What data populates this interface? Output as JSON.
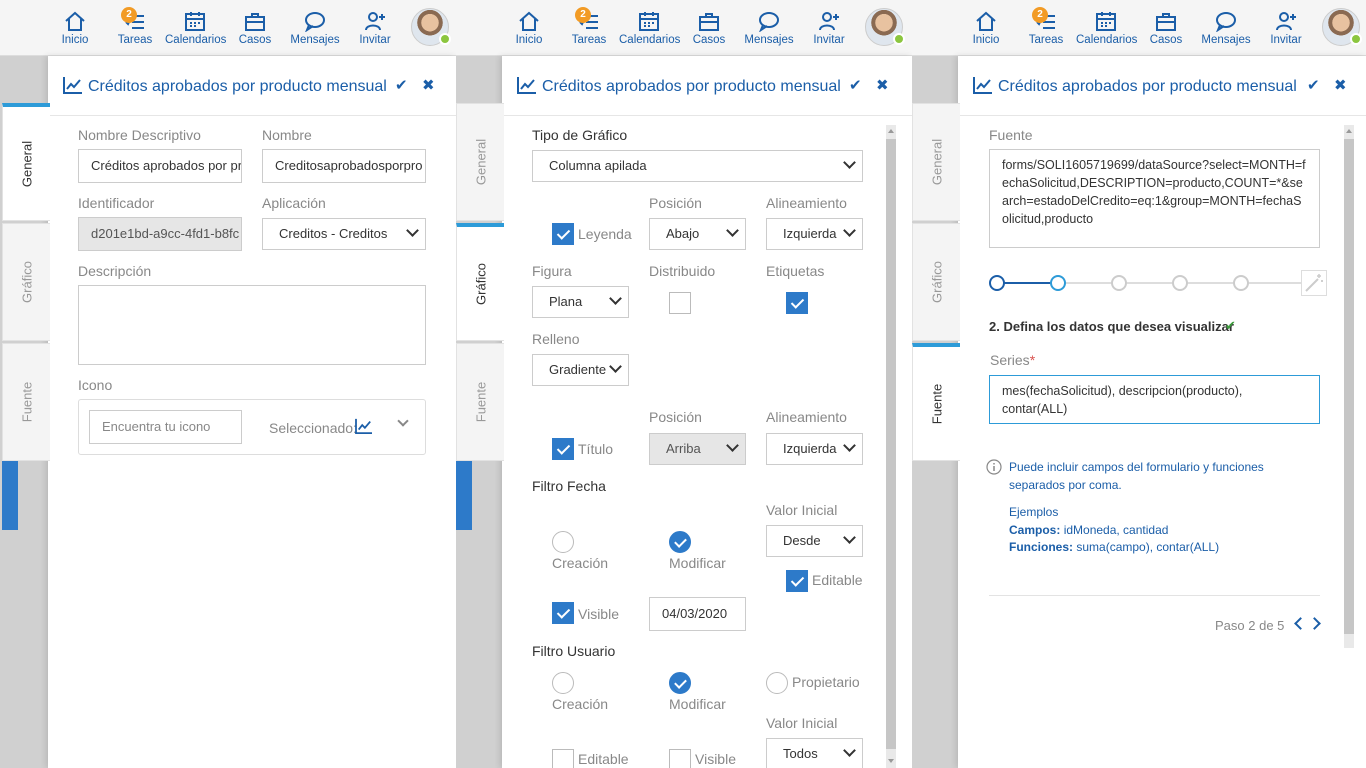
{
  "nav": {
    "inicio": "Inicio",
    "tareas": "Tareas",
    "tareas_badge": "2",
    "calendarios": "Calendarios",
    "casos": "Casos",
    "mensajes": "Mensajes",
    "invitar": "Invitar"
  },
  "panel": {
    "title": "Créditos aprobados por producto mensual",
    "tabs": {
      "general": "General",
      "grafico": "Gráfico",
      "fuente": "Fuente"
    }
  },
  "general": {
    "nombre_descriptivo_label": "Nombre Descriptivo",
    "nombre_descriptivo_value": "Créditos aprobados por pr",
    "nombre_label": "Nombre",
    "nombre_value": "Creditosaprobadosporpro",
    "identificador_label": "Identificador",
    "identificador_value": "d201e1bd-a9cc-4fd1-b8fc",
    "aplicacion_label": "Aplicación",
    "aplicacion_value": "Creditos - Creditos",
    "descripcion_label": "Descripción",
    "descripcion_value": "",
    "icono_label": "Icono",
    "icono_placeholder": "Encuentra tu icono",
    "seleccionado_label": "Seleccionado:"
  },
  "grafico": {
    "tipo_label": "Tipo de Gráfico",
    "tipo_value": "Columna apilada",
    "posicion_label": "Posición",
    "alineamiento_label": "Alineamiento",
    "leyenda_label": "Leyenda",
    "leyenda_posicion": "Abajo",
    "leyenda_alineamiento": "Izquierda",
    "figura_label": "Figura",
    "figura_value": "Plana",
    "distribuido_label": "Distribuido",
    "etiquetas_label": "Etiquetas",
    "relleno_label": "Relleno",
    "relleno_value": "Gradiente",
    "posicion2_label": "Posición",
    "alineamiento2_label": "Alineamiento",
    "titulo_label": "Título",
    "titulo_posicion": "Arriba",
    "titulo_alineamiento": "Izquierda",
    "filtro_fecha_label": "Filtro Fecha",
    "valor_inicial_label": "Valor Inicial",
    "creacion_label": "Creación",
    "modificar_label": "Modificar",
    "fecha_valor_inicial": "Desde",
    "editable_label": "Editable",
    "visible_label": "Visible",
    "fecha_value": "04/03/2020",
    "filtro_usuario_label": "Filtro Usuario",
    "creacion2_label": "Creación",
    "modificar2_label": "Modificar",
    "propietario_label": "Propietario",
    "valor_inicial2_label": "Valor Inicial",
    "editable2_label": "Editable",
    "visible2_label": "Visible",
    "usuario_valor_inicial": "Todos"
  },
  "fuente": {
    "fuente_label": "Fuente",
    "fuente_value": "forms/SOLI1605719699/dataSource?select=MONTH=fechaSolicitud,DESCRIPTION=producto,COUNT=*&search=estadoDelCredito=eq:1&group=MONTH=fechaSolicitud,producto",
    "step_title": "2. Defina los datos que desea visualizar",
    "series_label": "Series",
    "required_mark": "*",
    "series_value": "mes(fechaSolicitud), descripcion(producto), contar(ALL)",
    "info_line1": "Puede incluir campos del formulario y funciones",
    "info_line2": "separados por coma.",
    "ejemplos": "Ejemplos",
    "campos_label": "Campos:",
    "campos_value": "idMoneda, cantidad",
    "funciones_label": "Funciones:",
    "funciones_value": "suma(campo), contar(ALL)",
    "paso_text": "Paso 2 de 5"
  }
}
